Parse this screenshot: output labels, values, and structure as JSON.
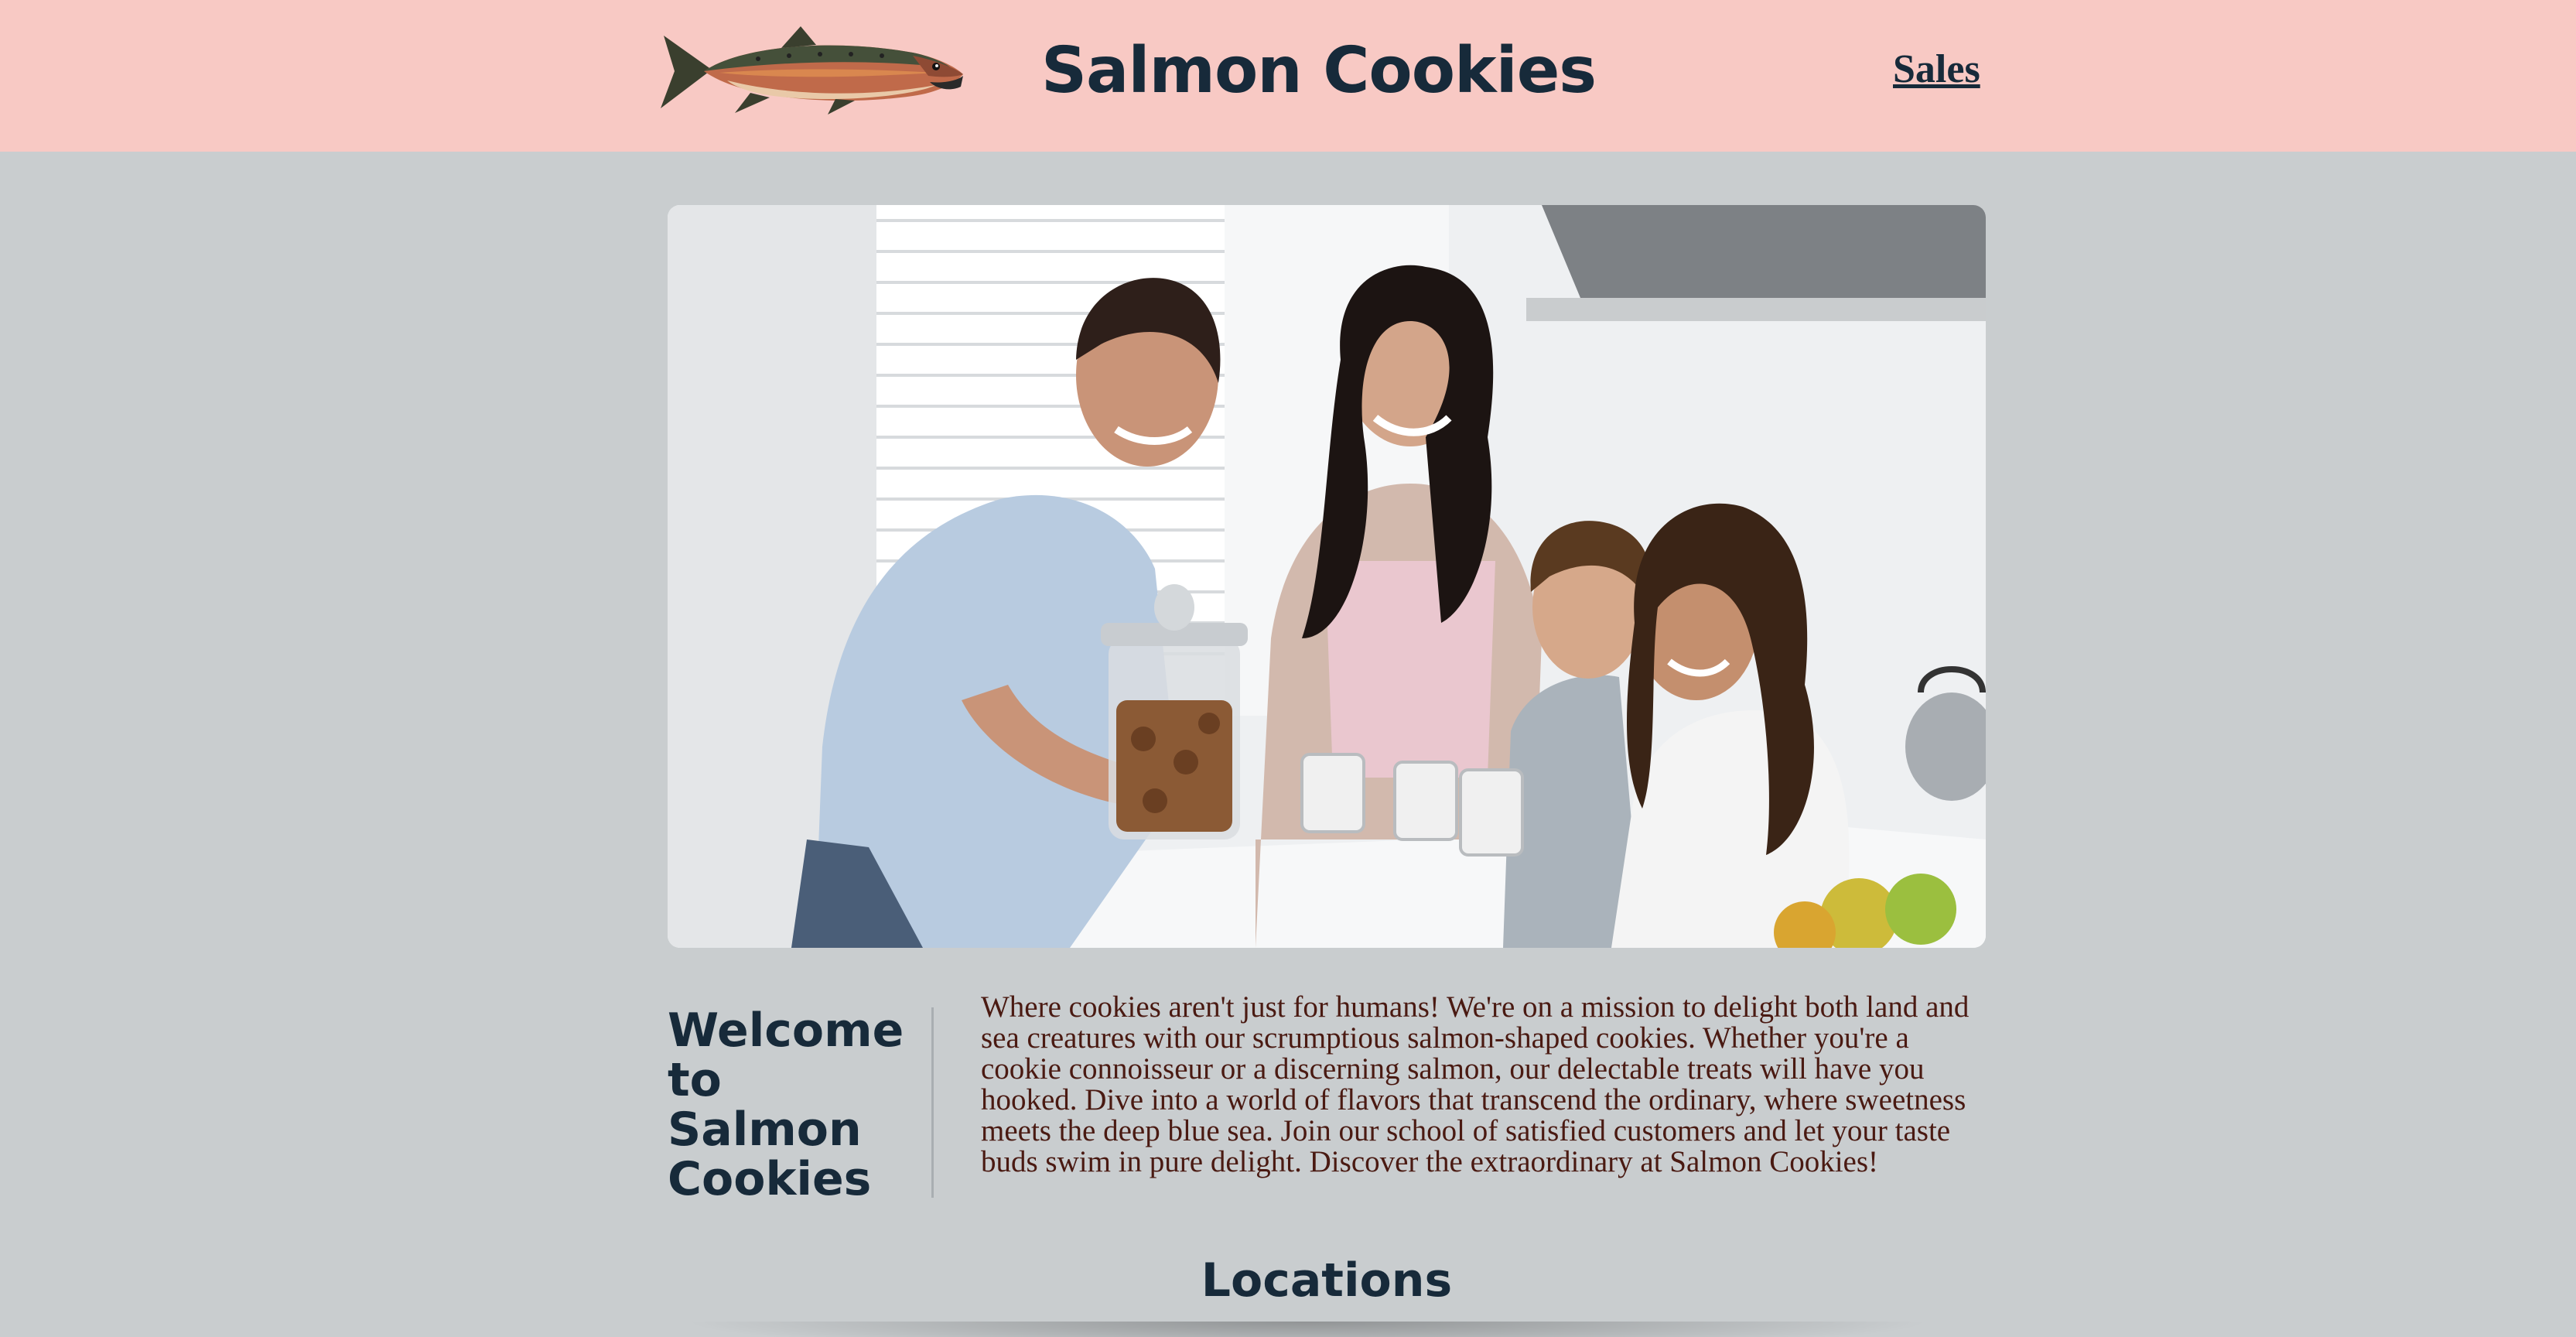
{
  "header": {
    "logo_icon": "salmon-fish-icon",
    "title": "Salmon Cookies",
    "nav_sales": "Sales",
    "background": "#f8c9c4"
  },
  "hero": {
    "image": "family-with-cookie-jar-photo"
  },
  "welcome": {
    "heading_line1": "Welcome",
    "heading_line2": "to",
    "heading_line3": "Salmon",
    "heading_line4": "Cookies",
    "body": "Where cookies aren't just for humans! We're on a mission to delight both land and sea creatures with our scrumptious salmon-shaped cookies. Whether you're a cookie connoisseur or a discerning salmon, our delectable treats will have you hooked. Dive into a world of flavors that transcend the ordinary, where sweetness meets the deep blue sea. Join our school of satisfied customers and let your taste buds swim in pure delight. Discover the extraordinary at Salmon Cookies!"
  },
  "sections": {
    "locations_heading": "Locations"
  },
  "colors": {
    "page_background": "#c9cdcf",
    "heading": "#172a3a",
    "body_text": "#4a1a12"
  }
}
